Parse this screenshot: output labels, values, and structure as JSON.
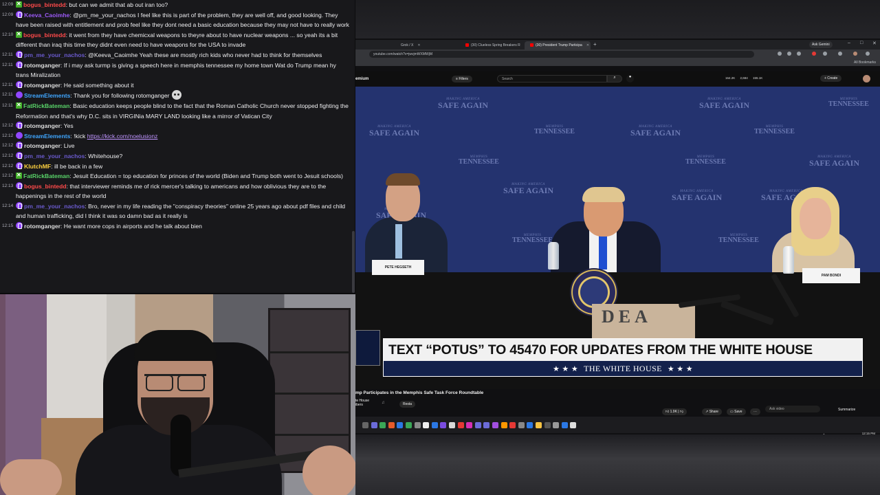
{
  "chat": {
    "messages": [
      {
        "time": "12:09",
        "badge": "vip",
        "user": "bogus_bintedd",
        "color": "#ff4a4a",
        "text": "but can we admit that ab out iran too?"
      },
      {
        "time": "12:09",
        "badge": "sub",
        "user": "Keeva_Caoimhe",
        "color": "#9b59f5",
        "text": "@pm_me_your_nachos I feel like this is part of the problem, they are well off, and good looking. They have been raised with entitlement and prob feel like they dont need a basic education because they may not have to really work"
      },
      {
        "time": "12:10",
        "badge": "vip",
        "user": "bogus_bintedd",
        "color": "#ff4a4a",
        "text": "it went from they have chemicxal weapons to theyre about to have nuclear weapons ... so yeah its a bit different than iraq this time they didnt even need to have weapons for the USA to invade"
      },
      {
        "time": "12:11",
        "badge": "sub",
        "user": "pm_me_your_nachos",
        "color": "#6a5acd",
        "text": "@Keeva_Caoimhe Yeah these are mostly rich kids who never had to think for themselves"
      },
      {
        "time": "12:11",
        "badge": "sub",
        "user": "rotomganger",
        "color": "#dcdcdc",
        "text": "If i may ask turmp is giving a speech here in memphis tennessee my home town Wat do Trump mean hy trans Miralization"
      },
      {
        "time": "12:11",
        "badge": "sub",
        "user": "rotomganger",
        "color": "#dcdcdc",
        "text": "He said something about it"
      },
      {
        "time": "12:11",
        "badge": "bot",
        "user": "StreamElements",
        "color": "#3fa6ff",
        "text": "Thank you for following rotomganger",
        "emote": true
      },
      {
        "time": "12:11",
        "badge": "vip",
        "user": "FatRickBateman",
        "color": "#5ad56a",
        "text": "Basic education keeps people blind to the fact that the Roman Catholic Church never stopped fighting the Reformation and that's why D.C. sits in VIRGINia MARY LAND looking like a mirror of Vatican City"
      },
      {
        "time": "12:12",
        "badge": "sub",
        "user": "rotomganger",
        "color": "#dcdcdc",
        "text": "Yes"
      },
      {
        "time": "12:12",
        "badge": "bot",
        "user": "StreamElements",
        "color": "#3fa6ff",
        "text": "!kick ",
        "link": "https://kick.com/noelusionz"
      },
      {
        "time": "12:12",
        "badge": "sub",
        "user": "rotomganger",
        "color": "#dcdcdc",
        "text": "Live"
      },
      {
        "time": "12:12",
        "badge": "sub",
        "user": "pm_me_your_nachos",
        "color": "#6a5acd",
        "text": "Whitehouse?"
      },
      {
        "time": "12:12",
        "badge": "sub",
        "user": "KlutchMF",
        "color": "#ffd23f",
        "text": "ill be back in a few"
      },
      {
        "time": "12:12",
        "badge": "vip",
        "user": "FatRickBateman",
        "color": "#5ad56a",
        "text": "Jesuit Education = top education for princes of the world (Biden and Trump both went to Jesuit schools)"
      },
      {
        "time": "12:13",
        "badge": "sub",
        "user": "bogus_bintedd",
        "color": "#ff4a4a",
        "text": "that interviewer reminds me of rick mercer's talking to americans and how oblivious they are to the happenings in the rest of the world"
      },
      {
        "time": "12:14",
        "badge": "sub",
        "user": "pm_me_your_nachos",
        "color": "#6a5acd",
        "text": "Bro, never in my life reading the \"conspiracy theories\" online 25 years ago about pdf files and child and human trafficking, did I think it was so damn bad as it really is"
      },
      {
        "time": "12:15",
        "badge": "sub",
        "user": "rotomganger",
        "color": "#dcdcdc",
        "text": "He want more cops in airports and he talk about bien"
      }
    ]
  },
  "browser": {
    "tabs": [
      "Grok / X",
      "(30) Clueless Spring Breakers R",
      "(30) President Trump Participa"
    ],
    "ask_gemini": "Ask Gemini",
    "url": "youtube.com/watch?v=jwvjmWXMWjM",
    "bookmarks": "All Bookmarks"
  },
  "youtube": {
    "logo": "emium",
    "filters": "Filters",
    "search_placeholder": "Search",
    "stats": "164.2K 2,684 155.1K",
    "create": "+ Create",
    "video_title": "mp Participates in the Memphis Safe Task Force Roundtable",
    "channel": "te House",
    "subscribers": "ibers",
    "subscribe": "Resta",
    "likes": "1.9K",
    "share": "Share",
    "save": "Save",
    "ask_placeholder": "Ask video",
    "summarize": "Summarize"
  },
  "video": {
    "backdrop_line1": "MAKING AMERICA",
    "backdrop_line2": "SAFE AGAIN",
    "backdrop_city": "MEMPHIS",
    "backdrop_state": "TENNESSEE",
    "nameplate_left": "PETE HEGSETH",
    "nameplate_right": "PAM BONDI",
    "box_text": "DEA",
    "lower_third_main": "TEXT “POTUS” TO 45470 FOR UPDATES FROM THE WHITE HOUSE",
    "lower_third_sub": "THE WHITE HOUSE",
    "stars": "★ ★ ★"
  },
  "clock": {
    "time": "12:15 PM",
    "date": "3/23/2026"
  }
}
